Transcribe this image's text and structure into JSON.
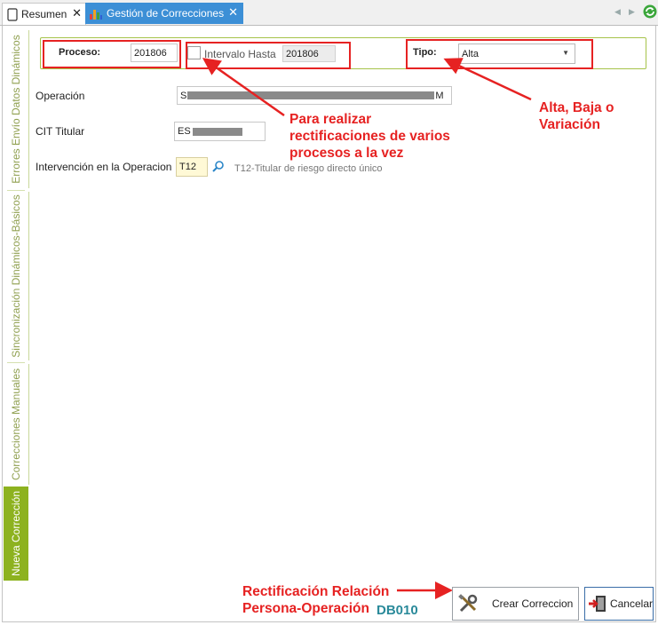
{
  "tabs": [
    {
      "label": "Resumen",
      "icon": "document-icon"
    },
    {
      "label": "Gestión de Correcciones",
      "icon": "bar-chart-icon"
    }
  ],
  "sidebar": {
    "items": [
      {
        "label": "Errores Envío Datos Dinámicos",
        "active": false
      },
      {
        "label": "Sincronización Dinámicos-Básicos",
        "active": false
      },
      {
        "label": "Correcciones Manuales",
        "active": false
      },
      {
        "label": "Nueva Corrección",
        "active": true
      }
    ]
  },
  "form": {
    "proceso_label": "Proceso:",
    "proceso_value": "201806",
    "intervalo_label": "Intervalo Hasta",
    "intervalo_value": "201806",
    "tipo_label": "Tipo:",
    "tipo_value": "Alta",
    "operacion_label": "Operación",
    "operacion_prefix": "S",
    "operacion_suffix": "M",
    "cit_label": "CIT Titular",
    "cit_prefix": "ES",
    "intervencion_label": "Intervención en la Operacion",
    "intervencion_value": "T12",
    "intervencion_desc": "T12-Titular de riesgo directo único"
  },
  "annotations": {
    "intervalo_note": [
      "Para realizar",
      "rectificaciones de varios",
      "procesos a la vez"
    ],
    "tipo_note": [
      "Alta, Baja o",
      "Variación"
    ],
    "crear_note": [
      "Rectificación Relación",
      "Persona-Operación"
    ],
    "code": "DB010"
  },
  "buttons": {
    "crear_label": "Crear Correccion",
    "cancelar_label": "Cancelar"
  },
  "colors": {
    "accent_green": "#8db21f",
    "tab_blue": "#3c8fd6",
    "annotation_red": "#e62222",
    "code_teal": "#2a8a9a"
  }
}
